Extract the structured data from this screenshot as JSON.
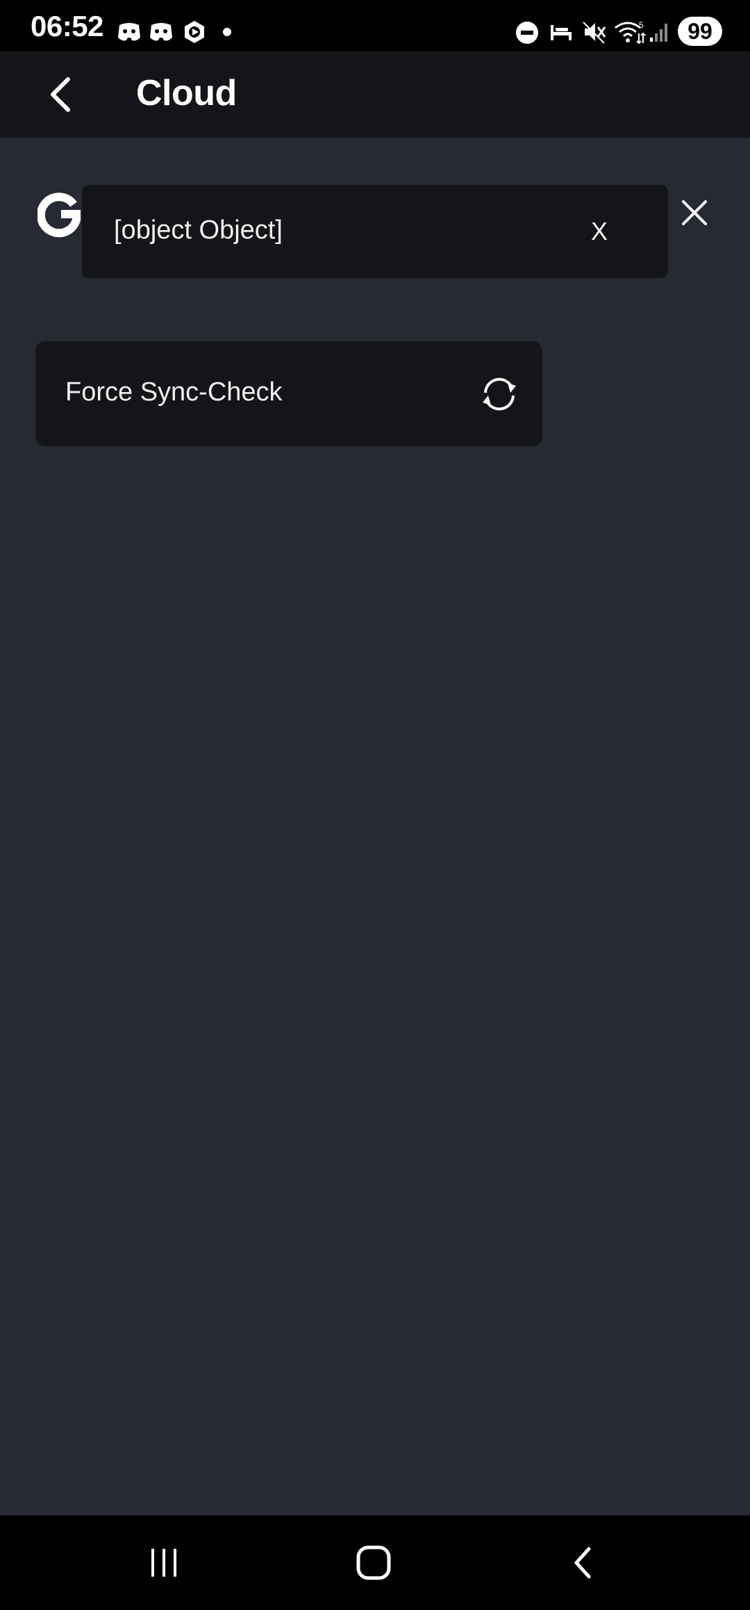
{
  "status_bar": {
    "time": "06:52",
    "battery": "99",
    "notification_icons": [
      "discord-icon",
      "discord-icon",
      "play-hexagon-icon",
      "dot-icon"
    ],
    "system_icons": [
      "do-not-disturb-icon",
      "sleep-icon",
      "mute-icon",
      "wifi-icon",
      "signal-icon"
    ]
  },
  "header": {
    "title": "Cloud",
    "back_icon": "chevron-left-icon"
  },
  "account": {
    "provider_icon": "google-g-icon"
  },
  "toast": {
    "message": "[object Object]",
    "close_label": "X"
  },
  "close_icon": "close-icon",
  "sync_card": {
    "label": "Force Sync-Check",
    "icon": "sync-icon"
  },
  "nav_bar": {
    "items": [
      "recent-apps-icon",
      "home-icon",
      "back-icon"
    ]
  },
  "colors": {
    "background": "#272a32",
    "surface": "#141518",
    "status_bar": "#000000",
    "text": "#ffffff"
  }
}
